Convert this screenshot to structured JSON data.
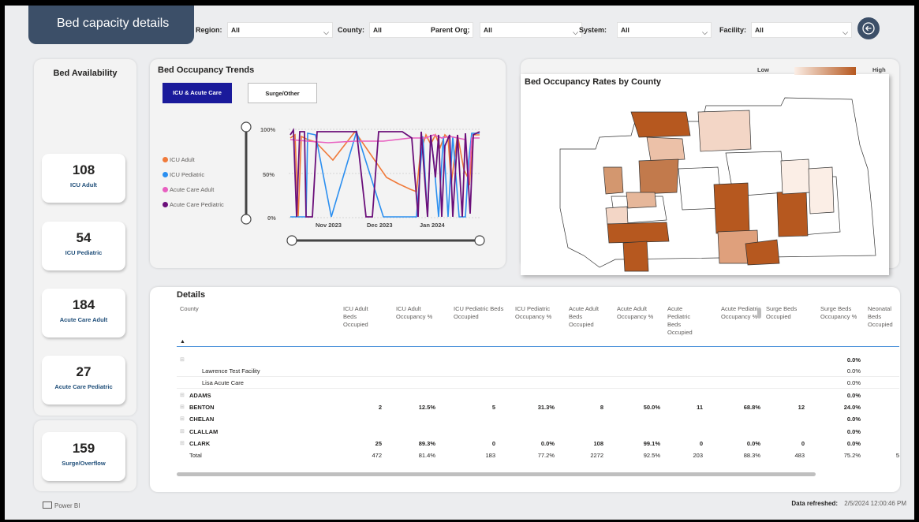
{
  "header": {
    "title": "Bed capacity details",
    "filters": [
      {
        "label": "Region:",
        "value": "All"
      },
      {
        "label": "County:",
        "value": "All"
      },
      {
        "label": "Parent Org:",
        "value": "All"
      },
      {
        "label": "System:",
        "value": "All"
      },
      {
        "label": "Facility:",
        "value": "All"
      }
    ]
  },
  "availability": {
    "title": "Bed Availability",
    "cards": [
      {
        "value": "108",
        "label": "ICU Adult"
      },
      {
        "value": "54",
        "label": "ICU Pediatric"
      },
      {
        "value": "184",
        "label": "Acute Care Adult"
      },
      {
        "value": "27",
        "label": "Acute Care Pediatric"
      },
      {
        "value": "159",
        "label": "Surge/Overflow"
      }
    ]
  },
  "trends": {
    "title": "Bed Occupancy Trends",
    "tabs": [
      "ICU & Acute Care",
      "Surge/Other"
    ],
    "active_tab": "ICU & Acute Care",
    "legend": [
      {
        "name": "ICU Adult",
        "color": "#f07a3a"
      },
      {
        "name": "ICU Pediatric",
        "color": "#2b8ff0"
      },
      {
        "name": "Acute  Care Adult",
        "color": "#e85fc0"
      },
      {
        "name": "Acute Care Pediatric",
        "color": "#6b0f7a"
      }
    ],
    "y_ticks": [
      "100%",
      "50%",
      "0%"
    ],
    "x_ticks": [
      "Nov 2023",
      "Dec 2023",
      "Jan 2024"
    ]
  },
  "map": {
    "title": "Bed Occupancy Rates by County",
    "legend_low": "Low",
    "legend_high": "High",
    "colors": {
      "low": "#fbeee6",
      "high": "#b6581f"
    }
  },
  "details": {
    "title": "Details",
    "columns": [
      "County",
      "ICU Adult Beds Occupied",
      "ICU Adult Occupancy %",
      "ICU Pediatric Beds Occupied",
      "ICU Pediatric Occupancy %",
      "Acute Adult Beds Occupied",
      "Acute Adult Occupancy %",
      "Acute Pediatric Beds Occupied",
      "Acute Pediatric Occupancy %",
      "Surge Beds Occupied",
      "Surge Beds Occupancy %",
      "Neonatal Beds Occupied"
    ],
    "rows": [
      {
        "name": "",
        "level": 0,
        "cells": [
          "",
          "",
          "",
          "",
          "",
          "",
          "",
          "",
          "",
          "0.0%",
          ""
        ]
      },
      {
        "name": "Lawrence Test Facility",
        "level": 1,
        "cells": [
          "",
          "",
          "",
          "",
          "",
          "",
          "",
          "",
          "",
          "0.0%",
          ""
        ]
      },
      {
        "name": "Lisa Acute Care",
        "level": 1,
        "cells": [
          "",
          "",
          "",
          "",
          "",
          "",
          "",
          "",
          "",
          "0.0%",
          ""
        ]
      },
      {
        "name": "ADAMS",
        "level": 0,
        "cells": [
          "",
          "",
          "",
          "",
          "",
          "",
          "",
          "",
          "",
          "0.0%",
          ""
        ]
      },
      {
        "name": "BENTON",
        "level": 0,
        "cells": [
          "2",
          "12.5%",
          "5",
          "31.3%",
          "8",
          "50.0%",
          "11",
          "68.8%",
          "12",
          "24.0%",
          ""
        ]
      },
      {
        "name": "CHELAN",
        "level": 0,
        "cells": [
          "",
          "",
          "",
          "",
          "",
          "",
          "",
          "",
          "",
          "0.0%",
          ""
        ]
      },
      {
        "name": "CLALLAM",
        "level": 0,
        "cells": [
          "",
          "",
          "",
          "",
          "",
          "",
          "",
          "",
          "",
          "0.0%",
          ""
        ]
      },
      {
        "name": "CLARK",
        "level": 0,
        "cells": [
          "25",
          "89.3%",
          "0",
          "0.0%",
          "108",
          "99.1%",
          "0",
          "0.0%",
          "0",
          "0.0%",
          ""
        ]
      }
    ],
    "total": {
      "name": "Total",
      "cells": [
        "472",
        "81.4%",
        "183",
        "77.2%",
        "2272",
        "92.5%",
        "203",
        "88.3%",
        "483",
        "75.2%",
        "5"
      ]
    }
  },
  "footer": {
    "brand": "Power BI",
    "refreshed_label": "Data refreshed:",
    "refreshed_value": "2/5/2024 12:00:46 PM"
  }
}
